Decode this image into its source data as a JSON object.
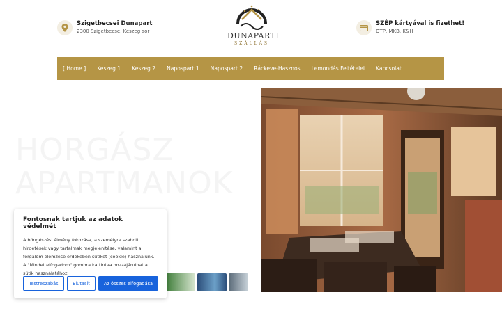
{
  "header": {
    "location": {
      "title": "Szigetbecsei Dunapart",
      "subtitle": "2300 Szigetbecse, Keszeg sor",
      "icon": "location-pin-icon"
    },
    "logo": {
      "word": "DUNAPARTI",
      "sub": "SZÁLLÁS"
    },
    "payment": {
      "title": "SZÉP kártyával is fizethet!",
      "subtitle": "OTP, MKB, K&H",
      "icon": "card-icon"
    }
  },
  "nav": {
    "items": [
      "[ Home ]",
      "Keszeg 1",
      "Keszeg 2",
      "Napospart 1",
      "Napospart 2",
      "Ráckeve-Hasznos",
      "Lemondás Feltételei",
      "Kapcsolat"
    ]
  },
  "hero": {
    "line1": "HORGÁSZ",
    "line2": "APARTMANOK"
  },
  "cookie": {
    "title": "Fontosnak tartjuk az adatok védelmét",
    "text": "A böngészési élmény fokozása, a személyre szabott hirdetések vagy tartalmak megjelenítése, valamint a forgalom elemzése érdekében sütiket (cookie) használunk. A \"Mindet elfogadom\" gombra kattintva hozzájárulhat a sütik használatához.",
    "btn_customize": "Testreszabás",
    "btn_reject": "Elutasít",
    "btn_accept": "Az összes elfogadása"
  },
  "colors": {
    "nav_bg": "#b59545",
    "accent_blue": "#1863dc"
  }
}
